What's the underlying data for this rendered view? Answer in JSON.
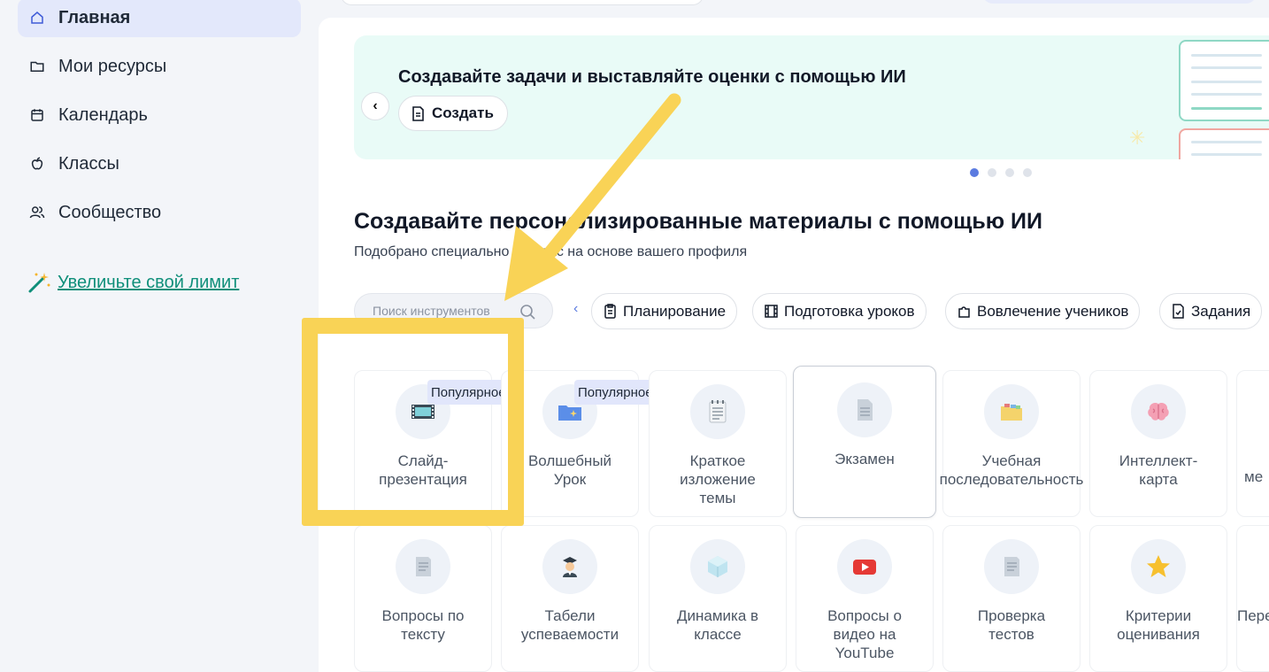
{
  "sidebar": {
    "items": [
      {
        "label": "Главная",
        "icon": "home-icon",
        "active": true
      },
      {
        "label": "Мои ресурсы",
        "icon": "folder-icon"
      },
      {
        "label": "Календарь",
        "icon": "calendar-icon"
      },
      {
        "label": "Классы",
        "icon": "apple-icon"
      },
      {
        "label": "Сообщество",
        "icon": "users-icon"
      }
    ],
    "limit_link": "Увеличьте свой лимит"
  },
  "banner": {
    "title": "Создавайте задачи и выставляйте оценки с помощью ИИ",
    "button": "Создать"
  },
  "section": {
    "title": "Создавайте персонализированные материалы с помощью ИИ",
    "subtitle": "Подобрано специально для вас на основе вашего профиля"
  },
  "tool_search": {
    "placeholder": "Поиск инструментов"
  },
  "chips": [
    "Планирование",
    "Подготовка уроков",
    "Вовлечение учеников",
    "Задания"
  ],
  "badge_label": "Популярное",
  "tools_row1": [
    {
      "label": "Слайд-\nпрезентация",
      "icon": "film-icon",
      "badge": true
    },
    {
      "label": "Волшебный\nУрок",
      "icon": "magic-folder-icon",
      "badge": true
    },
    {
      "label": "Краткое\nизложение\nтемы",
      "icon": "notepad-icon"
    },
    {
      "label": "Экзамен",
      "icon": "document-icon"
    },
    {
      "label": "Учебная\nпоследовательность",
      "icon": "folders-icon"
    },
    {
      "label": "Интеллект-\nкарта",
      "icon": "brain-icon"
    }
  ],
  "tools_row2": [
    {
      "label": "Вопросы по\nтексту",
      "icon": "text-doc-icon"
    },
    {
      "label": "Табели\nуспеваемости",
      "icon": "graduate-icon"
    },
    {
      "label": "Динамика в\nклассе",
      "icon": "cube-icon"
    },
    {
      "label": "Вопросы о\nвидео на\nYouTube",
      "icon": "youtube-icon"
    },
    {
      "label": "Проверка\nтестов",
      "icon": "test-doc-icon"
    },
    {
      "label": "Критерии\nоценивания",
      "icon": "star-icon"
    }
  ],
  "partial_labels": {
    "row1": "ме",
    "row2": "Пере"
  },
  "colors": {
    "accent": "#5b7be0",
    "highlight": "#f9d356",
    "link": "#0f8f7a"
  }
}
